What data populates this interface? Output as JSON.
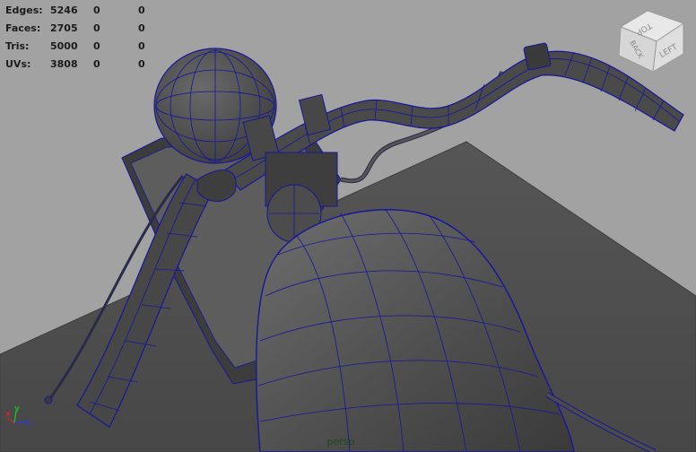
{
  "hud": {
    "rows": [
      {
        "label": "Edges:",
        "v1": "5246",
        "v2": "0",
        "v3": "0"
      },
      {
        "label": "Faces:",
        "v1": "2705",
        "v2": "0",
        "v3": "0"
      },
      {
        "label": "Tris:",
        "v1": "5000",
        "v2": "0",
        "v3": "0"
      },
      {
        "label": "UVs:",
        "v1": "3808",
        "v2": "0",
        "v3": "0"
      }
    ]
  },
  "viewcube": {
    "top": "TOP",
    "left": "LEFT",
    "back": "BACK"
  },
  "axis": {
    "x": "x",
    "y": "y",
    "z": "z"
  },
  "camera": {
    "name": "persp"
  },
  "colors": {
    "background": "#a2a2a2",
    "ground": "#525252",
    "mesh": "#5a5a5a",
    "wireframe": "#17169a",
    "hud_text": "#1b1b1b"
  }
}
